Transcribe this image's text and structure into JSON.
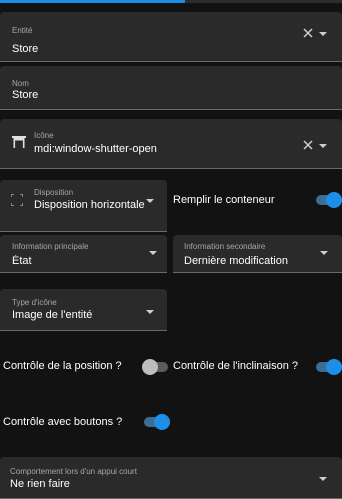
{
  "progress": {
    "value": 0.54
  },
  "entity": {
    "label": "Entité",
    "value": "Store"
  },
  "name": {
    "label": "Nom",
    "value": "Store"
  },
  "icon": {
    "label": "Icône",
    "value": "mdi:window-shutter-open",
    "icon_name": "window-shutter-open-icon"
  },
  "layout": {
    "label": "Disposition",
    "value": "Disposition horizontale",
    "icon_name": "layout-icon"
  },
  "fill_container": {
    "label": "Remplir le conteneur",
    "on": true
  },
  "primary_info": {
    "label": "Information principale",
    "value": "État"
  },
  "secondary_info": {
    "label": "Information secondaire",
    "value": "Dernière modification"
  },
  "icon_type": {
    "label": "Type d'icône",
    "value": "Image de l'entité"
  },
  "position_control": {
    "label": "Contrôle de la position ?",
    "on": false
  },
  "tilt_control": {
    "label": "Contrôle de l'inclinaison ?",
    "on": true
  },
  "buttons_control": {
    "label": "Contrôle avec boutons ?",
    "on": true
  },
  "tap_action": {
    "label": "Comportement lors d'un appui court",
    "value": "Ne rien faire"
  },
  "colors": {
    "accent": "#1e8fe8",
    "field_bg": "#2a2a2a",
    "page_bg": "#121212"
  }
}
